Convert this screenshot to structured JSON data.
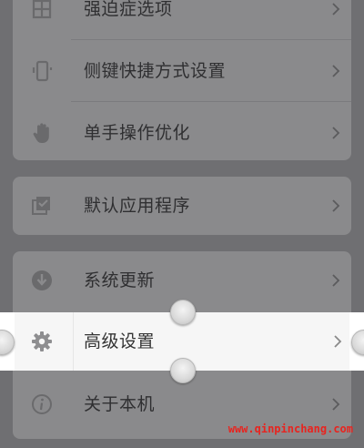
{
  "settings": {
    "items": [
      {
        "label": "强迫症选项",
        "icon": "grid-icon"
      },
      {
        "label": "侧键快捷方式设置",
        "icon": "phone-side-key-icon"
      },
      {
        "label": "单手操作优化",
        "icon": "hand-icon"
      },
      {
        "label": "默认应用程序",
        "icon": "default-apps-icon"
      },
      {
        "label": "系统更新",
        "icon": "download-icon"
      },
      {
        "label": "高级设置",
        "icon": "gear-icon"
      },
      {
        "label": "关于本机",
        "icon": "info-icon"
      }
    ]
  },
  "watermark": "www.qinpinchang.com",
  "colors": {
    "dim_background": "#6f6f72",
    "dim_card": "#8a8a8c",
    "highlight_background": "#f6f6f6",
    "watermark": "#e8241f"
  }
}
